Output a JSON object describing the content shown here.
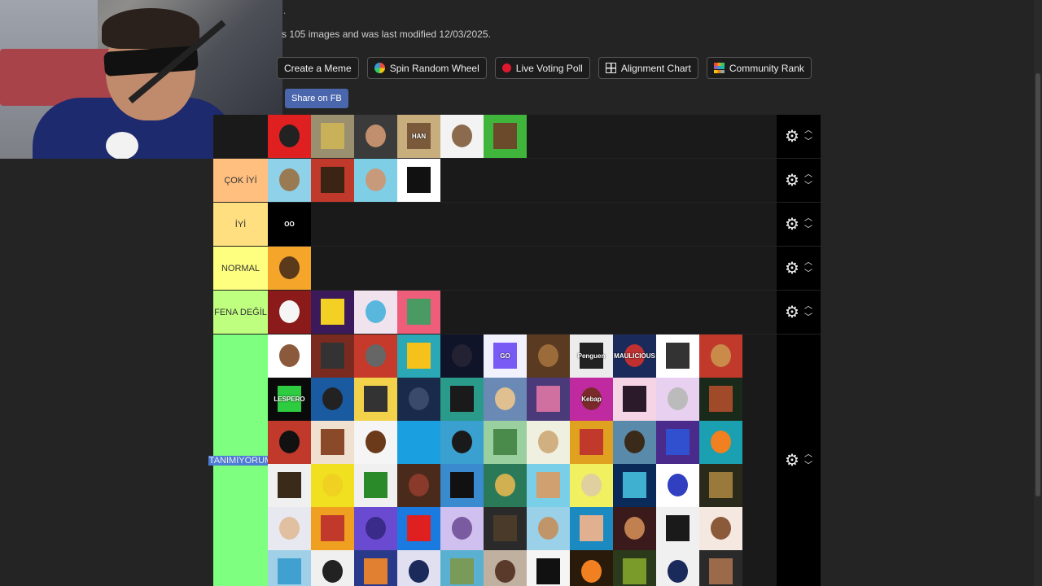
{
  "header": {
    "info_text": "s 105 images and was last modified 12/03/2025.",
    "dot": "."
  },
  "buttons": {
    "create_meme": "Create a Meme",
    "spin_wheel": "Spin Random Wheel",
    "live_poll": "Live Voting Poll",
    "alignment_chart": "Alignment Chart",
    "community_rank": "Community Rank",
    "share_fb": "Share on FB"
  },
  "tiers": [
    {
      "label": "",
      "color": "#ff7f7f",
      "items": [
        {
          "bg": "#e02020",
          "fg": "#222",
          "t": ""
        },
        {
          "bg": "#9a8f6f",
          "fg": "#c9b15a",
          "t": ""
        },
        {
          "bg": "#3b3b3b",
          "fg": "#c28f6c",
          "t": ""
        },
        {
          "bg": "#c9ae7d",
          "fg": "#7a5a3a",
          "t": "HAN"
        },
        {
          "bg": "#f3f3f3",
          "fg": "#8c6a4e",
          "t": ""
        },
        {
          "bg": "#3fb53c",
          "fg": "#6b4a2b",
          "t": ""
        }
      ]
    },
    {
      "label": "ÇOK İYİ",
      "color": "#ffbf7f",
      "items": [
        {
          "bg": "#8ed1e8",
          "fg": "#9a7a52",
          "t": ""
        },
        {
          "bg": "#c0392b",
          "fg": "#3b2414",
          "t": ""
        },
        {
          "bg": "#7ecfe6",
          "fg": "#c79a7b",
          "t": ""
        },
        {
          "bg": "#ffffff",
          "fg": "#111",
          "t": ""
        }
      ]
    },
    {
      "label": "İYİ",
      "color": "#ffdf7f",
      "items": [
        {
          "bg": "#000000",
          "fg": "#000",
          "t": "OO"
        }
      ]
    },
    {
      "label": "NORMAL",
      "color": "#ffff7f",
      "items": [
        {
          "bg": "#f4a52a",
          "fg": "#5a3a1a",
          "t": ""
        }
      ]
    },
    {
      "label": "FENA DEĞİL",
      "color": "#bfff7f",
      "items": [
        {
          "bg": "#8b1a1a",
          "fg": "#f5f5f5",
          "t": ""
        },
        {
          "bg": "#3a1a5a",
          "fg": "#f2d024",
          "t": ""
        },
        {
          "bg": "#f1e3ee",
          "fg": "#59b7de",
          "t": ""
        },
        {
          "bg": "#ee5d7a",
          "fg": "#4a9a64",
          "t": ""
        }
      ]
    },
    {
      "label": "TANIMIYORUM",
      "color": "#7fff7f",
      "items": [
        {
          "bg": "#ffffff",
          "fg": "#8b5a3c",
          "t": ""
        },
        {
          "bg": "#7a2a1e",
          "fg": "#333",
          "t": ""
        },
        {
          "bg": "#c53a2a",
          "fg": "#666",
          "t": ""
        },
        {
          "bg": "#2aa8b5",
          "fg": "#f4c21a",
          "t": ""
        },
        {
          "bg": "#0f1428",
          "fg": "#223",
          "t": ""
        },
        {
          "bg": "#f2f2ff",
          "fg": "#7a5af5",
          "t": "GO"
        },
        {
          "bg": "#5a3a20",
          "fg": "#9b6b3a",
          "t": ""
        },
        {
          "bg": "#ececec",
          "fg": "#222",
          "t": "Penguen"
        },
        {
          "bg": "#1a2a5a",
          "fg": "#c03030",
          "t": "MAULICIOUS"
        },
        {
          "bg": "#ffffff",
          "fg": "#333",
          "t": ""
        },
        {
          "bg": "#c0392b",
          "fg": "#c98a4a",
          "t": ""
        },
        {
          "bg": "#0a0a0a",
          "fg": "#2ecc40",
          "t": "LESPERO"
        },
        {
          "bg": "#1a5aa0",
          "fg": "#222",
          "t": ""
        },
        {
          "bg": "#f2d24a",
          "fg": "#333",
          "t": ""
        },
        {
          "bg": "#1a2a4a",
          "fg": "#3a4a6a",
          "t": ""
        },
        {
          "bg": "#2a9a8a",
          "fg": "#1a1a1a",
          "t": ""
        },
        {
          "bg": "#6a8ab5",
          "fg": "#e0c090",
          "t": ""
        },
        {
          "bg": "#4a3a7a",
          "fg": "#d070a0",
          "t": ""
        },
        {
          "bg": "#c02aa0",
          "fg": "#7a2a2a",
          "t": "Kebap"
        },
        {
          "bg": "#f5d5e5",
          "fg": "#2a1a2a",
          "t": ""
        },
        {
          "bg": "#e8d0f0",
          "fg": "#bbb",
          "t": ""
        },
        {
          "bg": "#1a2a1a",
          "fg": "#a04a2a",
          "t": ""
        },
        {
          "bg": "#c0392b",
          "fg": "#111",
          "t": ""
        },
        {
          "bg": "#f0e0d0",
          "fg": "#8a4a2a",
          "t": ""
        },
        {
          "bg": "#f5f5f5",
          "fg": "#6a3a1a",
          "t": ""
        },
        {
          "bg": "#1aa0e0",
          "fg": "#1aa0e0",
          "t": ""
        },
        {
          "bg": "#3aa0d0",
          "fg": "#1a1a1a",
          "t": ""
        },
        {
          "bg": "#9acfa0",
          "fg": "#4a8a4a",
          "t": ""
        },
        {
          "bg": "#f0f0e0",
          "fg": "#d0b080",
          "t": ""
        },
        {
          "bg": "#e0a020",
          "fg": "#c0392b",
          "t": ""
        },
        {
          "bg": "#5a8aaa",
          "fg": "#3a2a1a",
          "t": ""
        },
        {
          "bg": "#4a2a8a",
          "fg": "#3050d0",
          "t": ""
        },
        {
          "bg": "#1aa0b0",
          "fg": "#f08020",
          "t": ""
        },
        {
          "bg": "#f0f0f0",
          "fg": "#3a2a1a",
          "t": ""
        },
        {
          "bg": "#f0e020",
          "fg": "#f0d020",
          "t": ""
        },
        {
          "bg": "#f0f0f0",
          "fg": "#2a8a2a",
          "t": ""
        },
        {
          "bg": "#4a2a1a",
          "fg": "#8a3a2a",
          "t": ""
        },
        {
          "bg": "#3a8ad0",
          "fg": "#111",
          "t": ""
        },
        {
          "bg": "#2a7a5a",
          "fg": "#d0b050",
          "t": ""
        },
        {
          "bg": "#7acfe8",
          "fg": "#d0a070",
          "t": ""
        },
        {
          "bg": "#f0f060",
          "fg": "#e0d0a0",
          "t": ""
        },
        {
          "bg": "#0a2a5a",
          "fg": "#40b0d0",
          "t": ""
        },
        {
          "bg": "#ffffff",
          "fg": "#3040c0",
          "t": ""
        },
        {
          "bg": "#2a2a1a",
          "fg": "#9a7a3a",
          "t": ""
        },
        {
          "bg": "#e8e8f0",
          "fg": "#e0c0a0",
          "t": ""
        },
        {
          "bg": "#f0a020",
          "fg": "#c0392b",
          "t": ""
        },
        {
          "bg": "#6a4ad0",
          "fg": "#3a2a8a",
          "t": ""
        },
        {
          "bg": "#1a7ae0",
          "fg": "#e02020",
          "t": ""
        },
        {
          "bg": "#d0c0f0",
          "fg": "#7a5aa0",
          "t": ""
        },
        {
          "bg": "#2a2a2a",
          "fg": "#4a3a2a",
          "t": ""
        },
        {
          "bg": "#9ad0e8",
          "fg": "#c0956a",
          "t": ""
        },
        {
          "bg": "#1a8ac0",
          "fg": "#e0b090",
          "t": ""
        },
        {
          "bg": "#3a1a1a",
          "fg": "#c08050",
          "t": ""
        },
        {
          "bg": "#f0f0f0",
          "fg": "#1a1a1a",
          "t": ""
        },
        {
          "bg": "#f5e8e0",
          "fg": "#8a5a3a",
          "t": ""
        },
        {
          "bg": "#a0d0e8",
          "fg": "#40a0d0",
          "t": ""
        },
        {
          "bg": "#f0f0f0",
          "fg": "#222",
          "t": ""
        },
        {
          "bg": "#2a3a8a",
          "fg": "#e08030",
          "t": ""
        },
        {
          "bg": "#e0e0f0",
          "fg": "#1a2a5a",
          "t": ""
        },
        {
          "bg": "#5ab0d0",
          "fg": "#7a9a5a",
          "t": ""
        },
        {
          "bg": "#c0b0a0",
          "fg": "#5a3a2a",
          "t": ""
        },
        {
          "bg": "#f5f5f5",
          "fg": "#111",
          "t": ""
        },
        {
          "bg": "#2a1a0a",
          "fg": "#f08020",
          "t": ""
        },
        {
          "bg": "#2a3a1a",
          "fg": "#7a9a2a",
          "t": ""
        },
        {
          "bg": "#f0f0f0",
          "fg": "#1a2a5a",
          "t": ""
        },
        {
          "bg": "#2a2a2a",
          "fg": "#9a6a4a",
          "t": ""
        }
      ]
    }
  ]
}
